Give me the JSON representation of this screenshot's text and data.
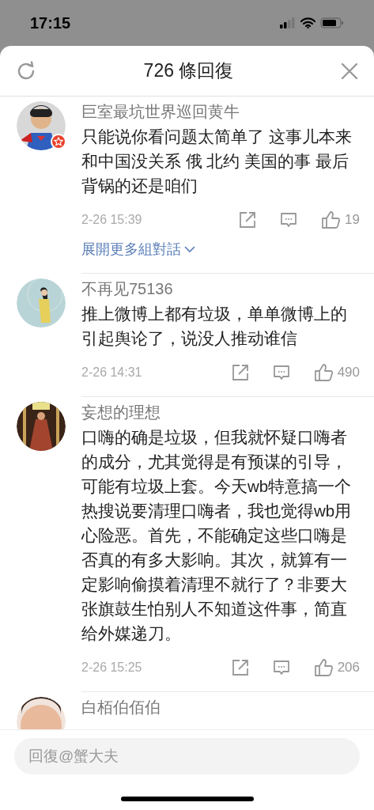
{
  "status_bar": {
    "time": "17:15"
  },
  "header": {
    "title": "726 條回復"
  },
  "comments": [
    {
      "name": "巨室最坑世界巡回黄牛",
      "verified_badge": true,
      "text": "只能说你看问题太简单了 这事儿本来和中国没关系 俄 北约 美国的事 最后背锅的还是咱们",
      "time": "2-26 15:39",
      "likes": "19",
      "more_link": "展開更多組對話"
    },
    {
      "name": "不再见75136",
      "verified_badge": false,
      "text": "推上微博上都有垃圾，单单微博上的引起舆论了，说没人推动谁信",
      "time": "2-26 14:31",
      "likes": "490"
    },
    {
      "name": "妄想的理想",
      "verified_badge": false,
      "text": "口嗨的确是垃圾，但我就怀疑口嗨者的成分，尤其觉得是有预谋的引导，可能有垃圾上套。今天wb特意搞一个热搜说要清理口嗨者，我也觉得wb用心险恶。首先，不能确定这些口嗨是否真的有多大影响。其次，就算有一定影响偷摸着清理不就行了？非要大张旗鼓生怕别人不知道这件事，简直给外媒递刀。",
      "time": "2-26 15:25",
      "likes": "206"
    },
    {
      "name": "白栢伯佰伯"
    }
  ],
  "reply_field": {
    "placeholder": "回復@蟹大夫"
  }
}
